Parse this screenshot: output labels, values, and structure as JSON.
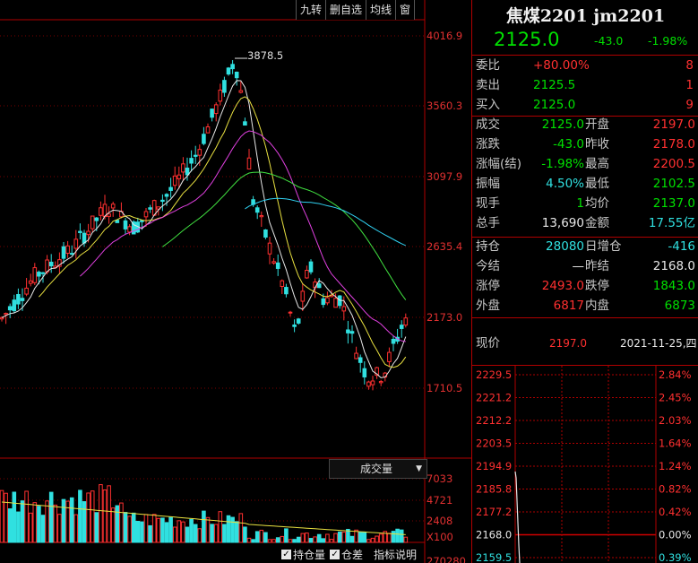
{
  "toolbar": {
    "jiuzhuan": "九转",
    "del_watch": "删自选",
    "average": "均线",
    "window": "窗"
  },
  "chart": {
    "price_ticks": [
      "4016.9",
      "3560.3",
      "3097.9",
      "2635.4",
      "2173.0",
      "1710.5"
    ],
    "high_marker": "3878.5",
    "volume_indicator": "成交量",
    "volume_ticks": [
      "7033",
      "4721",
      "2408",
      "X100"
    ],
    "bottom_partial": "270280"
  },
  "bottom_bar": {
    "hold_label": "持仓量",
    "diff_label": "仓差",
    "help_label": "指标说明"
  },
  "quote": {
    "title": "焦煤2201 jm2201",
    "last": "2125.0",
    "change": "-43.0",
    "change_pct": "-1.98%",
    "rows_top": [
      {
        "l": "委比",
        "v": "+80.00%",
        "n": "8"
      },
      {
        "l": "卖出",
        "v": "2125.5",
        "n": "1"
      },
      {
        "l": "买入",
        "v": "2125.0",
        "n": "9"
      }
    ],
    "rows_main": [
      {
        "l1": "成交",
        "v1": "2125.0",
        "l2": "开盘",
        "v2": "2197.0"
      },
      {
        "l1": "涨跌",
        "v1": "-43.0",
        "l2": "昨收",
        "v2": "2178.0"
      },
      {
        "l1": "涨幅(结)",
        "v1": "-1.98%",
        "l2": "最高",
        "v2": "2200.5"
      },
      {
        "l1": "振幅",
        "v1": "4.50%",
        "l2": "最低",
        "v2": "2102.5"
      },
      {
        "l1": "现手",
        "v1": "1",
        "l2": "均价",
        "v2": "2137.0"
      },
      {
        "l1": "总手",
        "v1": "13,690",
        "l2": "金额",
        "v2": "17.55亿"
      }
    ],
    "rows_pos": [
      {
        "l1": "持仓",
        "v1": "28080",
        "l2": "日增仓",
        "v2": "-416"
      },
      {
        "l1": "今结",
        "v1": "—",
        "l2": "昨结",
        "v2": "2168.0"
      },
      {
        "l1": "涨停",
        "v1": "2493.0",
        "l2": "跌停",
        "v2": "1843.0"
      },
      {
        "l1": "外盘",
        "v1": "6817",
        "l2": "内盘",
        "v2": "6873"
      }
    ],
    "current_label": "现价",
    "current_price": "2197.0",
    "date": "2021-11-25,四",
    "minute_left": [
      "2229.5",
      "2221.2",
      "2212.2",
      "2203.5",
      "2194.9",
      "2185.8",
      "2177.2",
      "2168.0",
      "2159.5"
    ],
    "minute_right": [
      "2.84%",
      "2.45%",
      "2.03%",
      "1.64%",
      "1.24%",
      "0.82%",
      "0.42%",
      "0.00%",
      "0.39%"
    ]
  },
  "colors": {
    "up": "#ff3030",
    "down": "#30e0e0",
    "axis": "#b00000"
  }
}
